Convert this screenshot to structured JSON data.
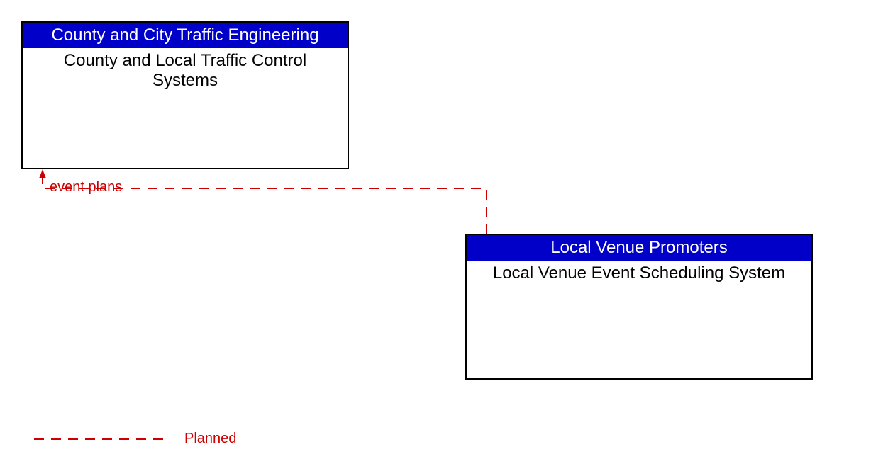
{
  "box1": {
    "header": "County and City Traffic Engineering",
    "body": "County and Local Traffic Control Systems"
  },
  "box2": {
    "header": "Local Venue Promoters",
    "body": "Local Venue Event Scheduling System"
  },
  "flow": {
    "label": "event plans"
  },
  "legend": {
    "planned": "Planned"
  },
  "colors": {
    "header_bg": "#0000c8",
    "flow_line": "#cc0000"
  }
}
